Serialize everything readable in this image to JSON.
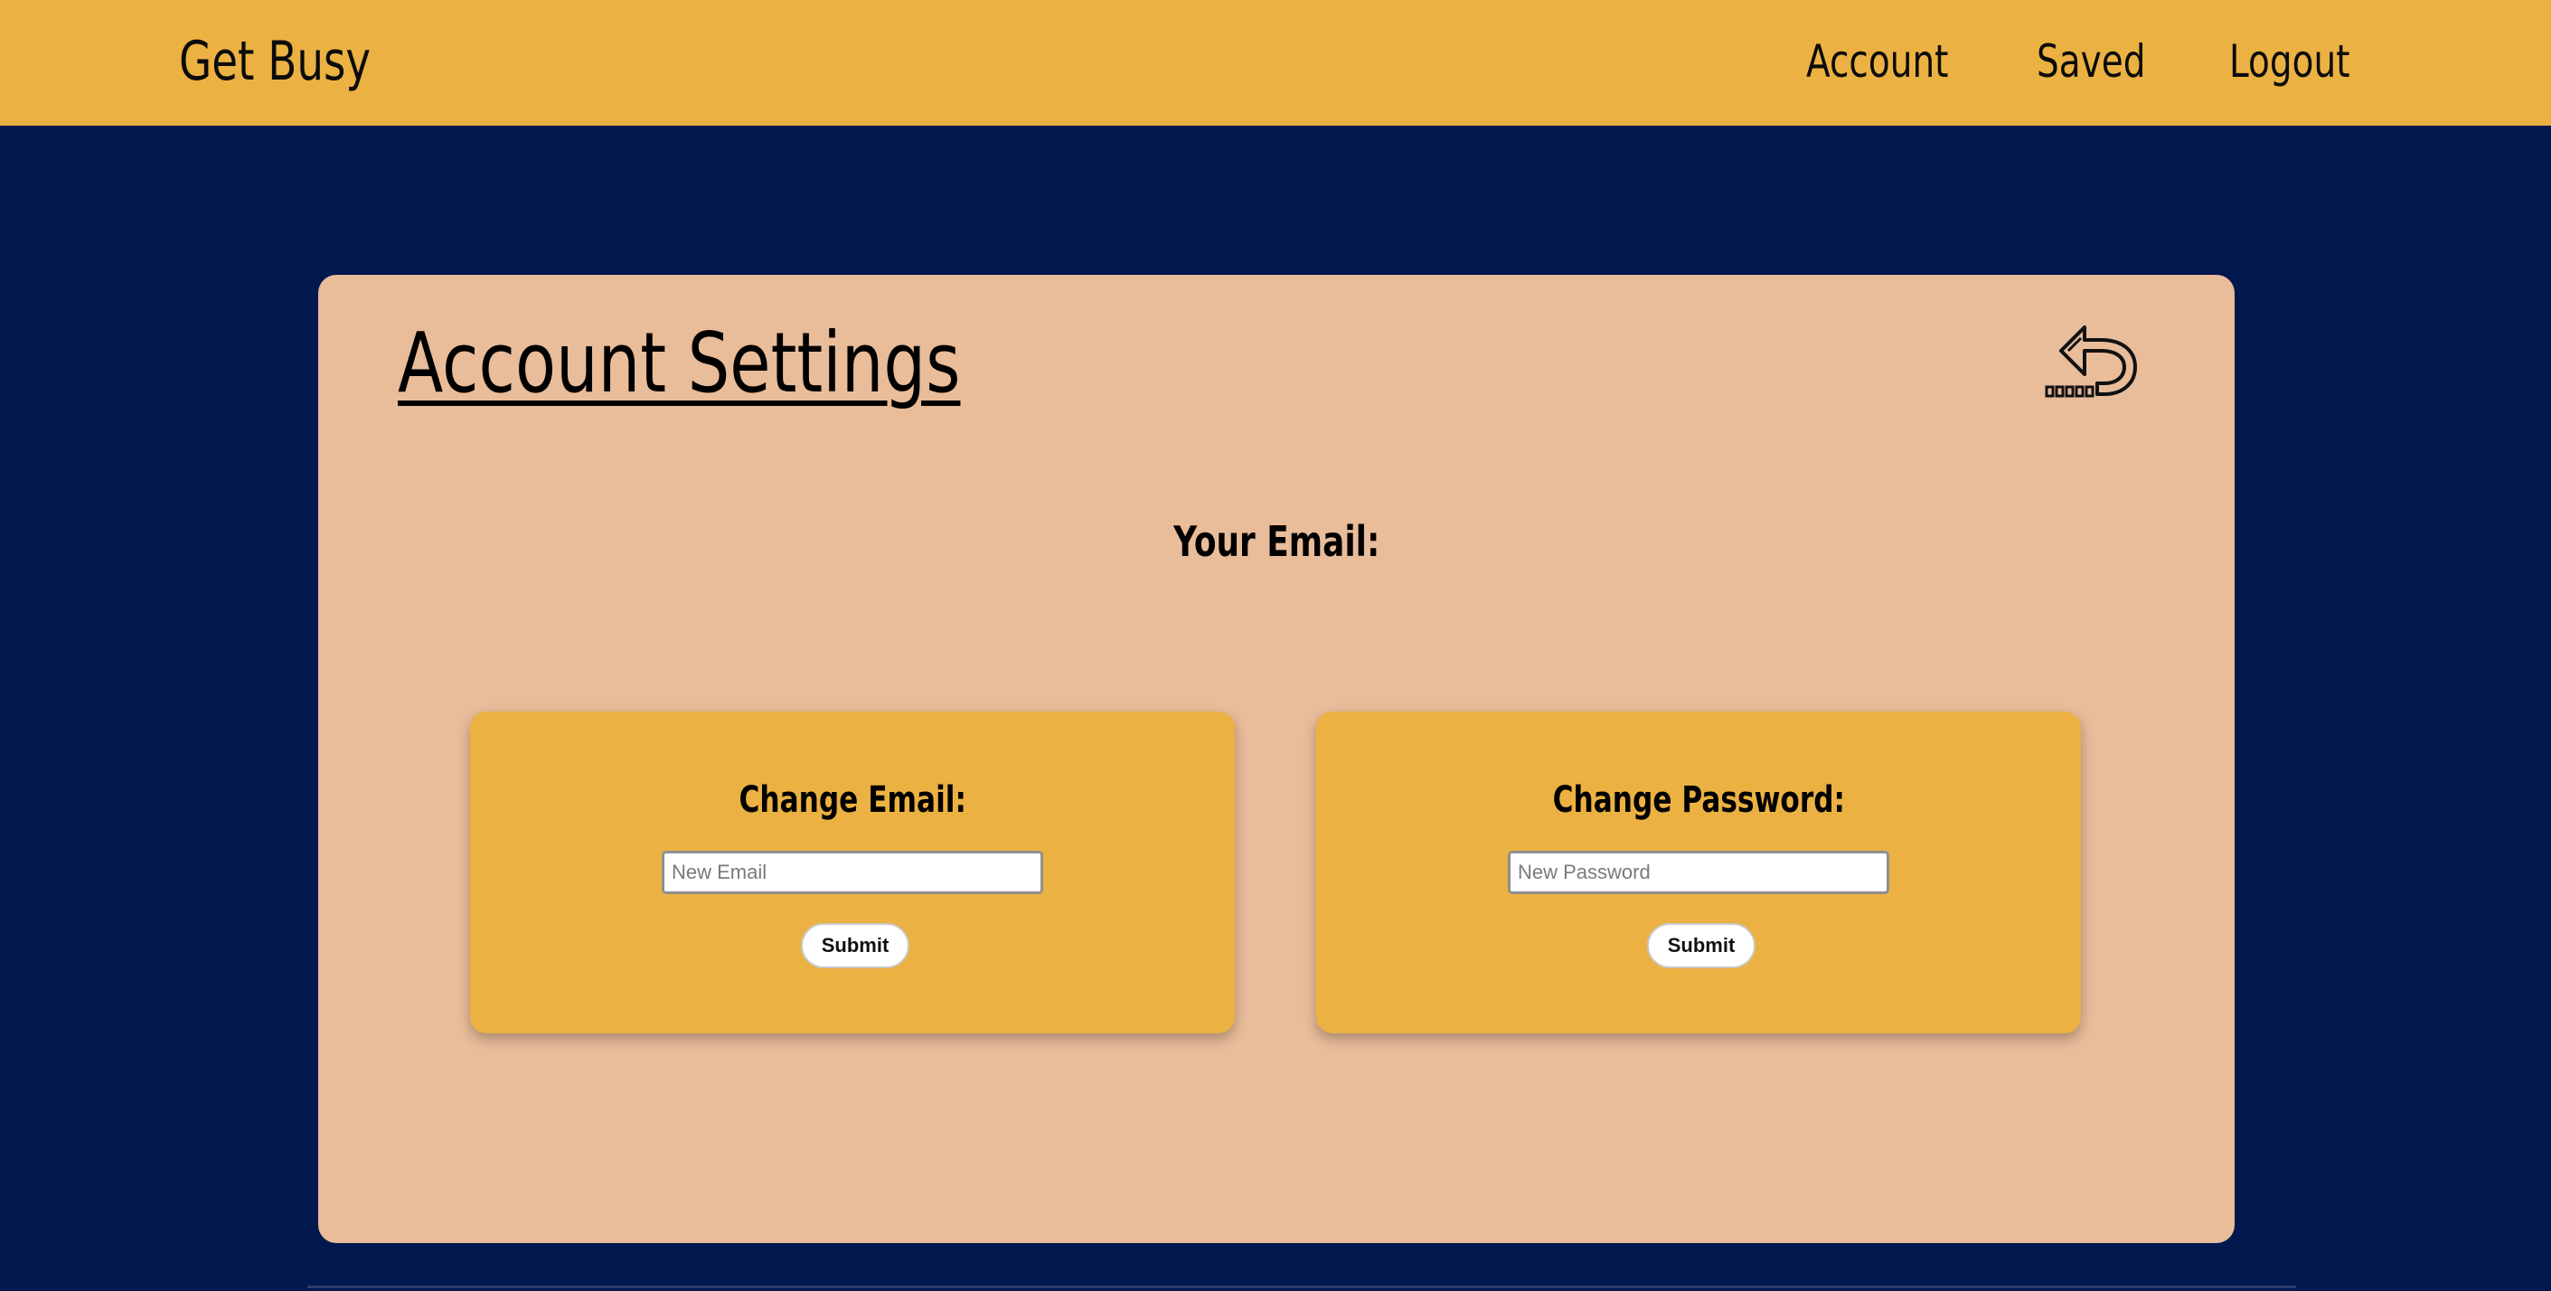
{
  "header": {
    "brand": "Get Busy",
    "nav": {
      "account": "Account",
      "saved": "Saved",
      "logout": "Logout"
    }
  },
  "panel": {
    "title": "Account Settings",
    "back_icon": "back-arrow-icon",
    "email_label": "Your Email:"
  },
  "change_email": {
    "title": "Change Email:",
    "placeholder": "New Email",
    "value": "",
    "submit_label": "Submit"
  },
  "change_password": {
    "title": "Change Password:",
    "placeholder": "New Password",
    "value": "",
    "submit_label": "Submit"
  },
  "colors": {
    "background": "#00184e",
    "header": "#ebb142",
    "panel": "#e9bc9a",
    "card": "#ebb142"
  }
}
